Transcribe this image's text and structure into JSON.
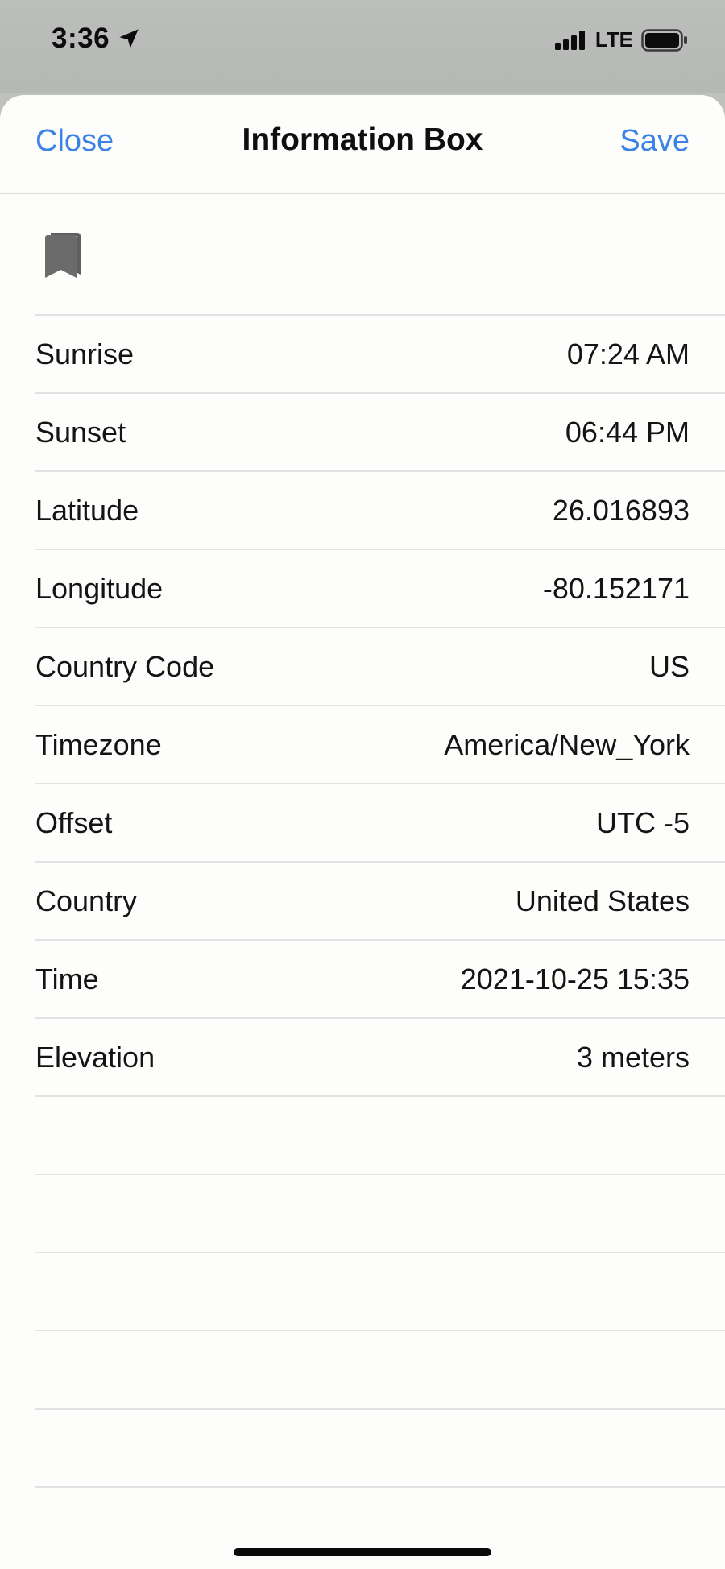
{
  "status_bar": {
    "time": "3:36",
    "network": "LTE",
    "icons": [
      "location-arrow-icon",
      "signal-bars-icon",
      "battery-icon"
    ]
  },
  "nav": {
    "close_label": "Close",
    "title": "Information Box",
    "save_label": "Save",
    "accent_color": "#3b82e6"
  },
  "header_icon": "bookmark-icon",
  "rows": [
    {
      "label": "Sunrise",
      "value": "07:24 AM"
    },
    {
      "label": "Sunset",
      "value": "06:44 PM"
    },
    {
      "label": "Latitude",
      "value": "26.016893"
    },
    {
      "label": "Longitude",
      "value": "-80.152171"
    },
    {
      "label": "Country Code",
      "value": "US"
    },
    {
      "label": "Timezone",
      "value": "America/New_York"
    },
    {
      "label": "Offset",
      "value": "UTC -5"
    },
    {
      "label": "Country",
      "value": "United States"
    },
    {
      "label": "Time",
      "value": "2021-10-25 15:35"
    },
    {
      "label": "Elevation",
      "value": "3 meters"
    }
  ]
}
